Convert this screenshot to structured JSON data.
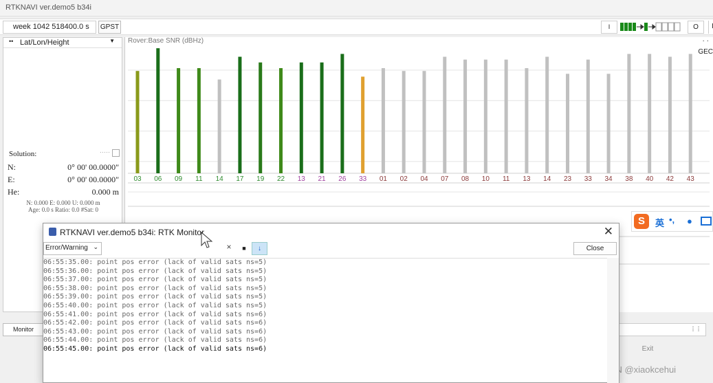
{
  "main_window": {
    "title": "RTKNAVI ver.demo5 b34i",
    "toolbar": {
      "time": "week 1042 518400.0 s",
      "time_system": "GPST",
      "info_btn": "I",
      "right_btn": "O",
      "edge_btn": "I"
    },
    "left_panel": {
      "view_mode": "Lat/Lon/Height",
      "solution_label": "Solution:",
      "rows": [
        {
          "key": "N:",
          "value": "0° 00' 00.0000\""
        },
        {
          "key": "E:",
          "value": "0° 00' 00.0000\""
        },
        {
          "key": "He:",
          "value": "0.000 m"
        }
      ],
      "enu_line": "N: 0.000 E: 0.000 U: 0.000 m",
      "age_line": "Age: 0.0 s Ratio: 0.0 #Sat: 0"
    },
    "chart_panel": {
      "title": "Rover:Base  SNR (dBHz)",
      "constellation_tag": "GEC"
    },
    "bottom": {
      "monitor_button": "Monitor",
      "exit_button": "Exit"
    }
  },
  "chart_data": {
    "type": "bar",
    "title": "Rover:Base  SNR (dBHz)",
    "ylabel": "",
    "ylim": [
      0,
      45
    ],
    "categories": [
      "03",
      "06",
      "09",
      "11",
      "14",
      "17",
      "19",
      "22",
      "13",
      "21",
      "26",
      "33",
      "01",
      "02",
      "04",
      "07",
      "08",
      "10",
      "11",
      "13",
      "14",
      "23",
      "33",
      "34",
      "38",
      "40",
      "42",
      "43"
    ],
    "values": [
      36,
      44,
      37,
      37,
      33,
      41,
      39,
      37,
      39,
      39,
      42,
      34,
      37,
      36,
      36,
      41,
      40,
      40,
      40,
      37,
      41,
      35,
      40,
      35,
      42,
      42,
      41,
      42
    ],
    "bar_colors": [
      "#8a9a1a",
      "#1a6e1a",
      "#3f8a1a",
      "#3f8a1a",
      "#c0c0c0",
      "#1a6e1a",
      "#2a7a1a",
      "#3f8a1a",
      "#1a6e1a",
      "#1a6e1a",
      "#1a6e1a",
      "#e0a030",
      "#c0c0c0",
      "#c0c0c0",
      "#c0c0c0",
      "#c0c0c0",
      "#c0c0c0",
      "#c0c0c0",
      "#c0c0c0",
      "#c0c0c0",
      "#c0c0c0",
      "#c0c0c0",
      "#c0c0c0",
      "#c0c0c0",
      "#c0c0c0",
      "#c0c0c0",
      "#c0c0c0",
      "#c0c0c0"
    ],
    "label_colors": [
      "#2e8b2e",
      "#2e8b2e",
      "#2e8b2e",
      "#2e8b2e",
      "#2e8b2e",
      "#2e8b2e",
      "#2e8b2e",
      "#2e8b2e",
      "#a040a0",
      "#a040a0",
      "#a040a0",
      "#a040a0",
      "#8b3a3a",
      "#8b3a3a",
      "#8b3a3a",
      "#8b3a3a",
      "#8b3a3a",
      "#8b3a3a",
      "#8b3a3a",
      "#8b3a3a",
      "#8b3a3a",
      "#8b3a3a",
      "#8b3a3a",
      "#8b3a3a",
      "#8b3a3a",
      "#8b3a3a",
      "#8b3a3a",
      "#8b3a3a"
    ],
    "grid": true
  },
  "ime_bar": {
    "logo": "S",
    "mode": "英",
    "punct": "•,"
  },
  "monitor_dialog": {
    "title": "RTKNAVI ver.demo5 b34i: RTK Monitor",
    "filter": "Error/Warning",
    "clear_glyph": "×",
    "stop_glyph": "■",
    "scroll_glyph": "↓",
    "close_button": "Close",
    "log_lines": [
      "06:55:35.00: point pos error (lack of valid sats ns=5)",
      "06:55:36.00: point pos error (lack of valid sats ns=5)",
      "06:55:37.00: point pos error (lack of valid sats ns=5)",
      "06:55:38.00: point pos error (lack of valid sats ns=5)",
      "06:55:39.00: point pos error (lack of valid sats ns=5)",
      "06:55:40.00: point pos error (lack of valid sats ns=5)",
      "06:55:41.00: point pos error (lack of valid sats ns=6)",
      "06:55:42.00: point pos error (lack of valid sats ns=6)",
      "06:55:43.00: point pos error (lack of valid sats ns=6)",
      "06:55:44.00: point pos error (lack of valid sats ns=6)",
      "06:55:45.00: point pos error (lack of valid sats ns=6)"
    ]
  },
  "watermark": "CSDN @xiaokcehui"
}
